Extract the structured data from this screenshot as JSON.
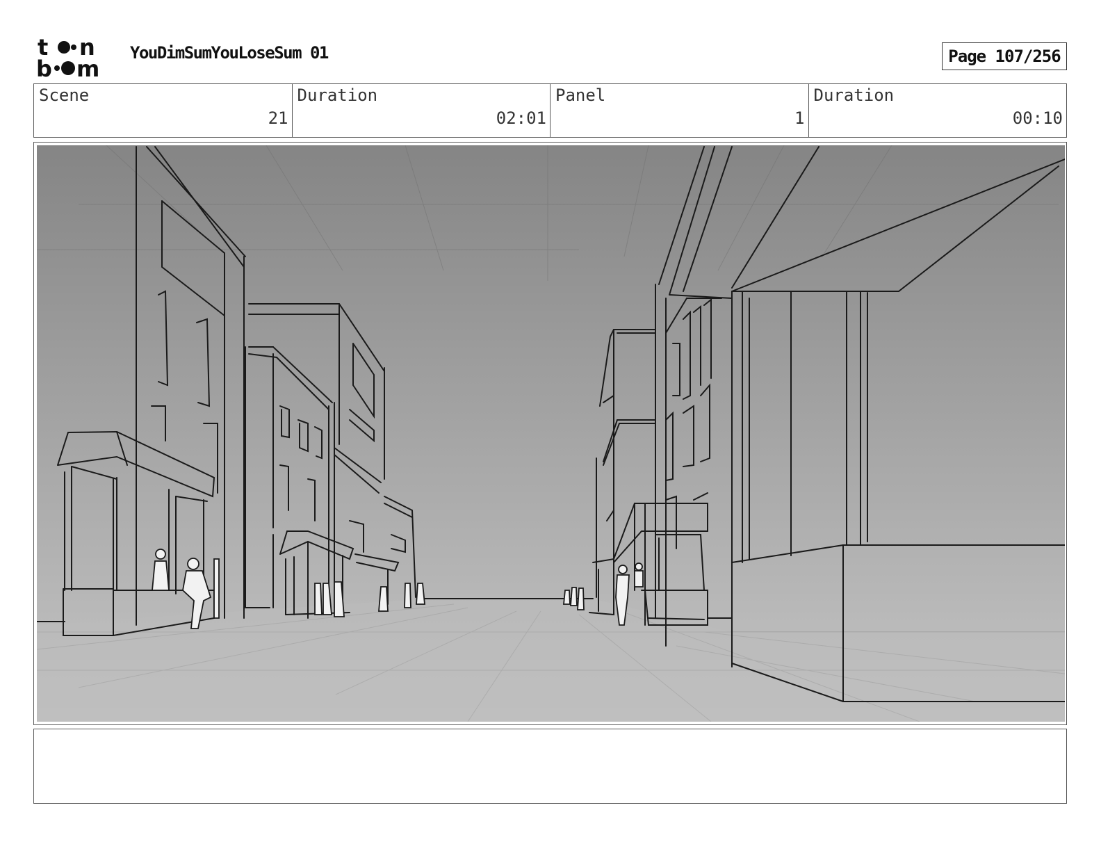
{
  "header": {
    "logo_text": [
      "t",
      "n",
      "b",
      "m"
    ],
    "title": "YouDimSumYouLoseSum 01",
    "page": "Page 107/256"
  },
  "info": {
    "scene_label": "Scene",
    "scene_value": "21",
    "scene_duration_label": "Duration",
    "scene_duration_value": "02:01",
    "panel_label": "Panel",
    "panel_value": "1",
    "panel_duration_label": "Duration",
    "panel_duration_value": "00:10"
  },
  "panel": {
    "description": "",
    "sky_color": "#8a8a8a",
    "ground_color": "#bdbdbd"
  },
  "notes": {
    "text": ""
  }
}
